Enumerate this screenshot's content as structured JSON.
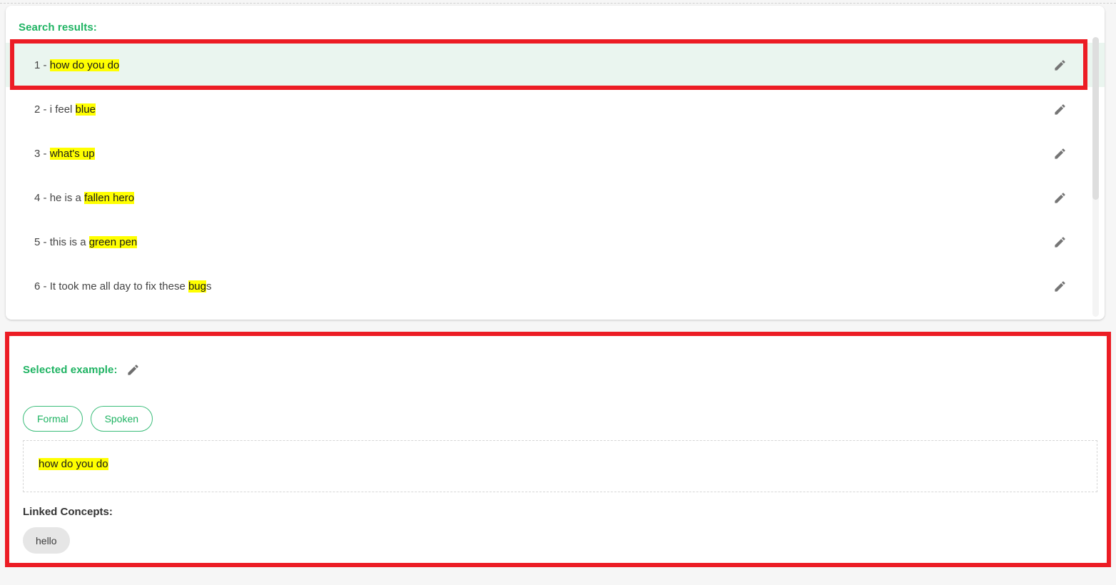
{
  "theme": {
    "accent_green": "#1eb362",
    "chip_border_green": "#3bbd7a",
    "annotation_red": "#ec1c24",
    "highlight_yellow": "#ffff00",
    "selected_row_bg": "#eaf5ef",
    "linked_chip_bg": "#e6e6e6"
  },
  "results": {
    "title": "Search results:",
    "edit_icon": "pencil-icon",
    "rows": [
      {
        "index": "1 - ",
        "prefix": "",
        "highlight": "how do you do",
        "suffix": "",
        "selected": true
      },
      {
        "index": "2 - ",
        "prefix": "i feel ",
        "highlight": "blue",
        "suffix": "",
        "selected": false
      },
      {
        "index": "3 - ",
        "prefix": "",
        "highlight": "what's up",
        "suffix": "",
        "selected": false
      },
      {
        "index": "4 - ",
        "prefix": "he is a ",
        "highlight": "fallen hero",
        "suffix": "",
        "selected": false
      },
      {
        "index": "5 - ",
        "prefix": "this is a ",
        "highlight": "green pen",
        "suffix": "",
        "selected": false
      },
      {
        "index": "6 - ",
        "prefix": "It took me all day to fix these ",
        "highlight": "bug",
        "suffix": "s",
        "selected": false
      }
    ]
  },
  "selected_example": {
    "title": "Selected example:",
    "edit_icon": "pencil-icon",
    "tags": [
      {
        "label": "Formal"
      },
      {
        "label": "Spoken"
      }
    ],
    "text_prefix": "",
    "text_highlight": "how do you do",
    "text_suffix": "",
    "linked_concepts_title": "Linked Concepts:",
    "linked_concepts": [
      {
        "label": "hello"
      }
    ]
  }
}
